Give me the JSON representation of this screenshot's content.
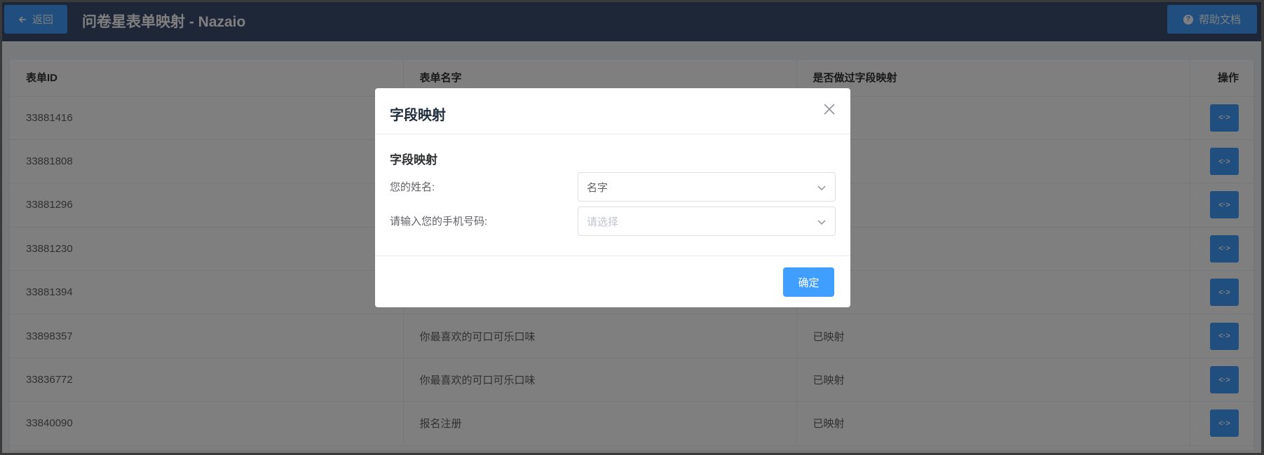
{
  "header": {
    "back_label": "返回",
    "title": "问卷星表单映射 - Nazaio",
    "help_label": "帮助文档"
  },
  "table": {
    "columns": [
      "表单ID",
      "表单名字",
      "是否做过字段映射",
      "操作"
    ],
    "rows": [
      {
        "id": "33881416",
        "name": "",
        "mapped": ""
      },
      {
        "id": "33881808",
        "name": "",
        "mapped": ""
      },
      {
        "id": "33881296",
        "name": "",
        "mapped": ""
      },
      {
        "id": "33881230",
        "name": "",
        "mapped": ""
      },
      {
        "id": "33881394",
        "name": "",
        "mapped": ""
      },
      {
        "id": "33898357",
        "name": "你最喜欢的可口可乐口味",
        "mapped": "已映射"
      },
      {
        "id": "33836772",
        "name": "你最喜欢的可口可乐口味",
        "mapped": "已映射"
      },
      {
        "id": "33840090",
        "name": "报名注册",
        "mapped": "已映射"
      }
    ],
    "action_symbol": "<·>"
  },
  "dialog": {
    "title": "字段映射",
    "section_title": "字段映射",
    "fields": [
      {
        "label": "您的姓名:",
        "value": "名字",
        "placeholder": ""
      },
      {
        "label": "请输入您的手机号码:",
        "value": "",
        "placeholder": "请选择"
      }
    ],
    "confirm_label": "确定"
  },
  "colors": {
    "primary": "#409eff",
    "topbar": "#3b4f71",
    "overlay": "rgba(0,0,0,0.5)"
  }
}
